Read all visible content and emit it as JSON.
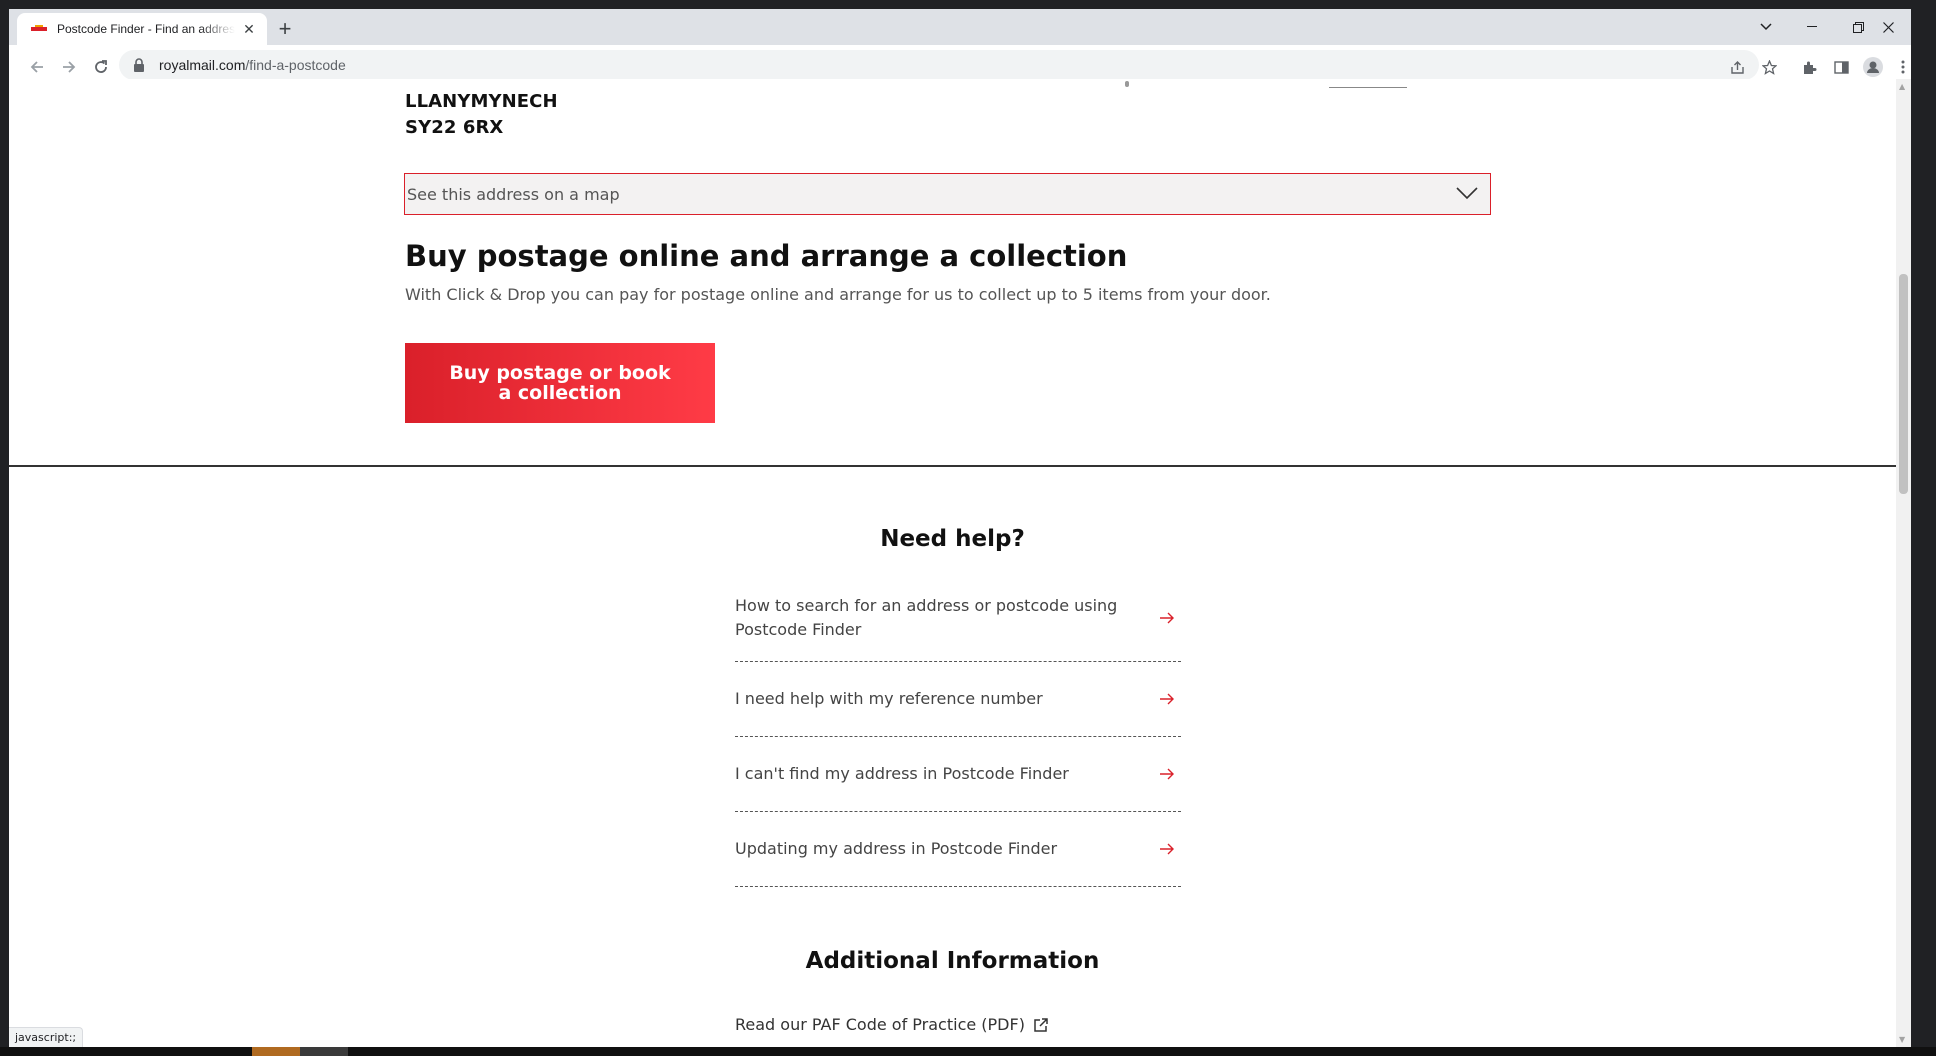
{
  "browser": {
    "tab_title": "Postcode Finder - Find an address",
    "url_host": "royalmail.com",
    "url_path": "/find-a-postcode",
    "status_text": "javascript:;"
  },
  "address": {
    "line_town": "LLANYMYNECH",
    "line_postcode": "SY22 6RX"
  },
  "map_select": {
    "label": "See this address on a map"
  },
  "postage": {
    "heading": "Buy postage online and arrange a collection",
    "description": "With Click & Drop you can pay for postage online and arrange for us to collect up to 5 items from your door.",
    "button_label": "Buy postage or book a collection"
  },
  "help": {
    "heading": "Need help?",
    "items": [
      {
        "label": "How to search for an address or postcode using Postcode Finder"
      },
      {
        "label": "I need help with my reference number"
      },
      {
        "label": "I can't find my address in Postcode Finder"
      },
      {
        "label": "Updating my address in Postcode Finder"
      }
    ]
  },
  "additional": {
    "heading": "Additional Information",
    "paf_link": "Read our PAF Code of Practice (PDF)"
  },
  "colors": {
    "brand_red": "#da202a",
    "brand_red_light": "#ff3b46"
  }
}
